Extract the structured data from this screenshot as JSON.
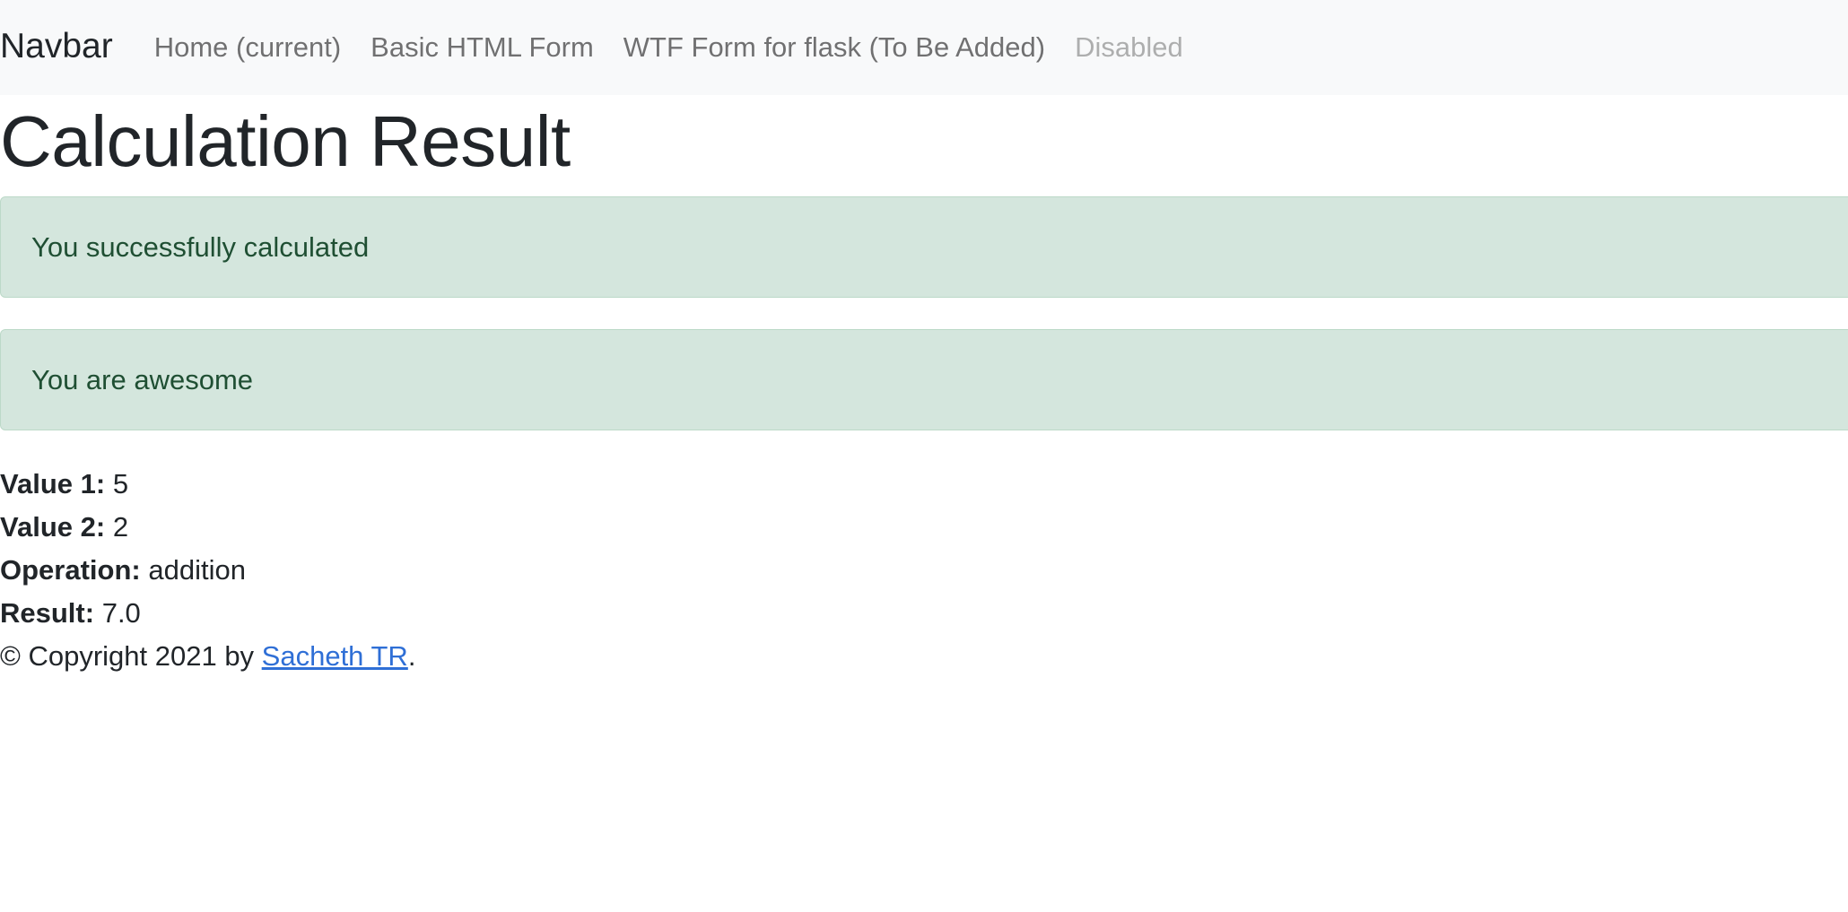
{
  "navbar": {
    "brand": "Navbar",
    "links": [
      {
        "label": "Home (current)"
      },
      {
        "label": "Basic HTML Form"
      },
      {
        "label": "WTF Form for flask (To Be Added)"
      },
      {
        "label": "Disabled"
      }
    ]
  },
  "page": {
    "title": "Calculation Result"
  },
  "alerts": [
    {
      "message": "You successfully calculated"
    },
    {
      "message": "You are awesome"
    }
  ],
  "details": [
    {
      "label": "Value 1:",
      "value": "5"
    },
    {
      "label": "Value 2:",
      "value": "2"
    },
    {
      "label": "Operation:",
      "value": "addition"
    },
    {
      "label": "Result:",
      "value": "7.0"
    }
  ],
  "footer": {
    "prefix": "© Copyright 2021 by ",
    "author": "Sacheth TR",
    "suffix": "."
  },
  "colors": {
    "navbar_bg": "#f8f9fa",
    "alert_bg": "#d4e6dd",
    "alert_text": "#1f4f33",
    "link": "#2f6fd6"
  }
}
